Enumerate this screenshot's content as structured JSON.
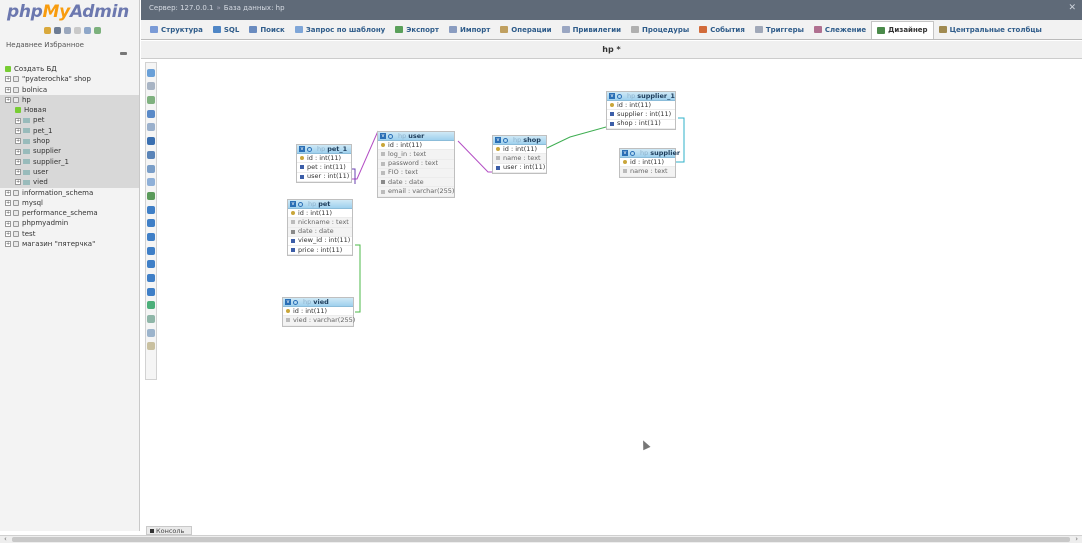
{
  "nav": {
    "logo_php": "php",
    "logo_my": "My",
    "logo_admin": "Admin",
    "recent_label": "Недавнее   Избранное",
    "tree": [
      {
        "label": "Создать БД",
        "kind": "new",
        "level": 0
      },
      {
        "label": "\"pyaterochka\" shop",
        "kind": "db",
        "level": 0
      },
      {
        "label": "bolnica",
        "kind": "db",
        "level": 0
      },
      {
        "label": "hp",
        "kind": "db",
        "level": 0,
        "selected": true
      },
      {
        "label": "Новая",
        "kind": "new",
        "level": 1,
        "selected": true
      },
      {
        "label": "pet",
        "kind": "table",
        "level": 1,
        "selected": true
      },
      {
        "label": "pet_1",
        "kind": "table",
        "level": 1,
        "selected": true
      },
      {
        "label": "shop",
        "kind": "table",
        "level": 1,
        "selected": true
      },
      {
        "label": "supplier",
        "kind": "table",
        "level": 1,
        "selected": true
      },
      {
        "label": "supplier_1",
        "kind": "table",
        "level": 1,
        "selected": true
      },
      {
        "label": "user",
        "kind": "table",
        "level": 1,
        "selected": true
      },
      {
        "label": "vied",
        "kind": "table",
        "level": 1,
        "selected": true
      },
      {
        "label": "information_schema",
        "kind": "db",
        "level": 0
      },
      {
        "label": "mysql",
        "kind": "db",
        "level": 0
      },
      {
        "label": "performance_schema",
        "kind": "db",
        "level": 0
      },
      {
        "label": "phpmyadmin",
        "kind": "db",
        "level": 0
      },
      {
        "label": "test",
        "kind": "db",
        "level": 0
      },
      {
        "label": "магазин \"пятерчка\"",
        "kind": "db",
        "level": 0
      }
    ]
  },
  "topbar": {
    "server": "Сервер: 127.0.0.1",
    "database": "База данных: hp"
  },
  "menu": {
    "tabs": [
      {
        "label": "Структура",
        "icon": "structure-icon",
        "color": "#7a9ad6"
      },
      {
        "label": "SQL",
        "icon": "sql-icon",
        "color": "#4f86c6"
      },
      {
        "label": "Поиск",
        "icon": "search-icon",
        "color": "#6a8bbf"
      },
      {
        "label": "Запрос по шаблону",
        "icon": "query-icon",
        "color": "#7fa6d8"
      },
      {
        "label": "Экспорт",
        "icon": "export-icon",
        "color": "#5aa05a"
      },
      {
        "label": "Импорт",
        "icon": "import-icon",
        "color": "#8a9cc0"
      },
      {
        "label": "Операции",
        "icon": "wrench-icon",
        "color": "#c0a060"
      },
      {
        "label": "Привилегии",
        "icon": "privileges-icon",
        "color": "#9aa6c2"
      },
      {
        "label": "Процедуры",
        "icon": "routines-icon",
        "color": "#b0b0b0"
      },
      {
        "label": "События",
        "icon": "events-icon",
        "color": "#d26b3a"
      },
      {
        "label": "Триггеры",
        "icon": "triggers-icon",
        "color": "#a0a8b8"
      },
      {
        "label": "Слежение",
        "icon": "tracking-icon",
        "color": "#b07090"
      },
      {
        "label": "Дизайнер",
        "icon": "designer-icon",
        "color": "#4a8a4a",
        "active": true
      },
      {
        "label": "Центральные столбцы",
        "icon": "columns-icon",
        "color": "#a08a50"
      }
    ]
  },
  "designer": {
    "title": "hp *"
  },
  "tables": {
    "pet_1": {
      "db": "hp",
      "name": "pet_1",
      "cols": [
        "id : int(11)",
        "pet : int(11)",
        "user : int(11)"
      ],
      "icons": [
        "key",
        "fk",
        "fk"
      ]
    },
    "user": {
      "db": "hp",
      "name": "user",
      "cols": [
        "id : int(11)",
        "log_in : text",
        "password : text",
        "FIO : text",
        "date : date",
        "email : varchar(255)"
      ],
      "icons": [
        "key",
        "txt",
        "txt",
        "txt",
        "date",
        "txt"
      ]
    },
    "shop": {
      "db": "hp",
      "name": "shop",
      "cols": [
        "id : int(11)",
        "name : text",
        "user : int(11)"
      ],
      "icons": [
        "key",
        "txt",
        "fk"
      ]
    },
    "supplier_1": {
      "db": "hp",
      "name": "supplier_1",
      "cols": [
        "id : int(11)",
        "supplier : int(11)",
        "shop : int(11)"
      ],
      "icons": [
        "key",
        "fk",
        "fk"
      ]
    },
    "supplier": {
      "db": "hp",
      "name": "supplier",
      "cols": [
        "id : int(11)",
        "name : text"
      ],
      "icons": [
        "key",
        "txt"
      ]
    },
    "pet": {
      "db": "hp",
      "name": "pet",
      "cols": [
        "id : int(11)",
        "nickname : text",
        "date : date",
        "view_id : int(11)",
        "price : int(11)"
      ],
      "icons": [
        "key",
        "txt",
        "date",
        "fk",
        "fk"
      ]
    },
    "vied": {
      "db": "hp",
      "name": "vied",
      "cols": [
        "id : int(11)",
        "vied : varchar(255)"
      ],
      "icons": [
        "key",
        "txt"
      ]
    }
  },
  "relation_colors": {
    "pet_user": "#b34dc4",
    "pet1_pet": "#6a3fb0",
    "shop_user": "#b34dc4",
    "supplier1_shop": "#3fae52",
    "supplier1_supplier": "#2fb0c8",
    "pet_vied": "#4cb848"
  },
  "console": {
    "label": "Консоль"
  }
}
